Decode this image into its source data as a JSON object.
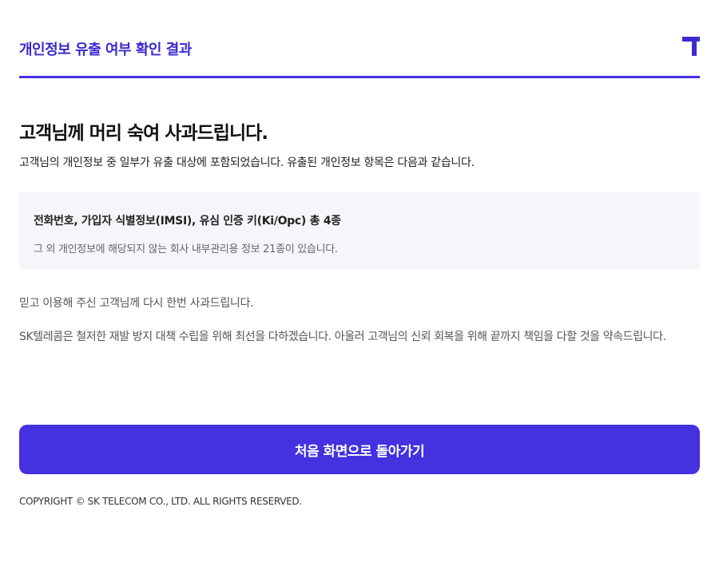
{
  "header": {
    "title": "개인정보 유출 여부 확인 결과",
    "logo_icon": "sk-telecom-t-logo",
    "accent_color": "#4431e0"
  },
  "main": {
    "headline": "고객님께 머리 숙여 사과드립니다.",
    "intro": "고객님의 개인정보 중 일부가 유출 대상에 포함되었습니다. 유출된 개인정보 항목은 다음과 같습니다.",
    "info_box": {
      "leaked_items": "전화번호, 가입자 식별정보(IMSI), 유심 인증 키(Ki/Opc) 총 4종",
      "note": "그 외 개인정보에 해당되지 않는 회사 내부관리용 정보 21종이 있습니다."
    },
    "apology": "믿고 이용해 주신 고객님께 다시 한번 사과드립니다.",
    "commitment": "SK텔레콤은 철저한 재발 방지 대책 수립을 위해 최선을 다하겠습니다. 아울러 고객님의 신뢰 회복을 위해 끝까지 책임을 다할 것을 약속드립니다."
  },
  "actions": {
    "home_button_label": "처음 화면으로 돌아가기"
  },
  "footer": {
    "copyright": "COPYRIGHT © SK TELECOM CO., LTD. ALL RIGHTS RESERVED."
  }
}
